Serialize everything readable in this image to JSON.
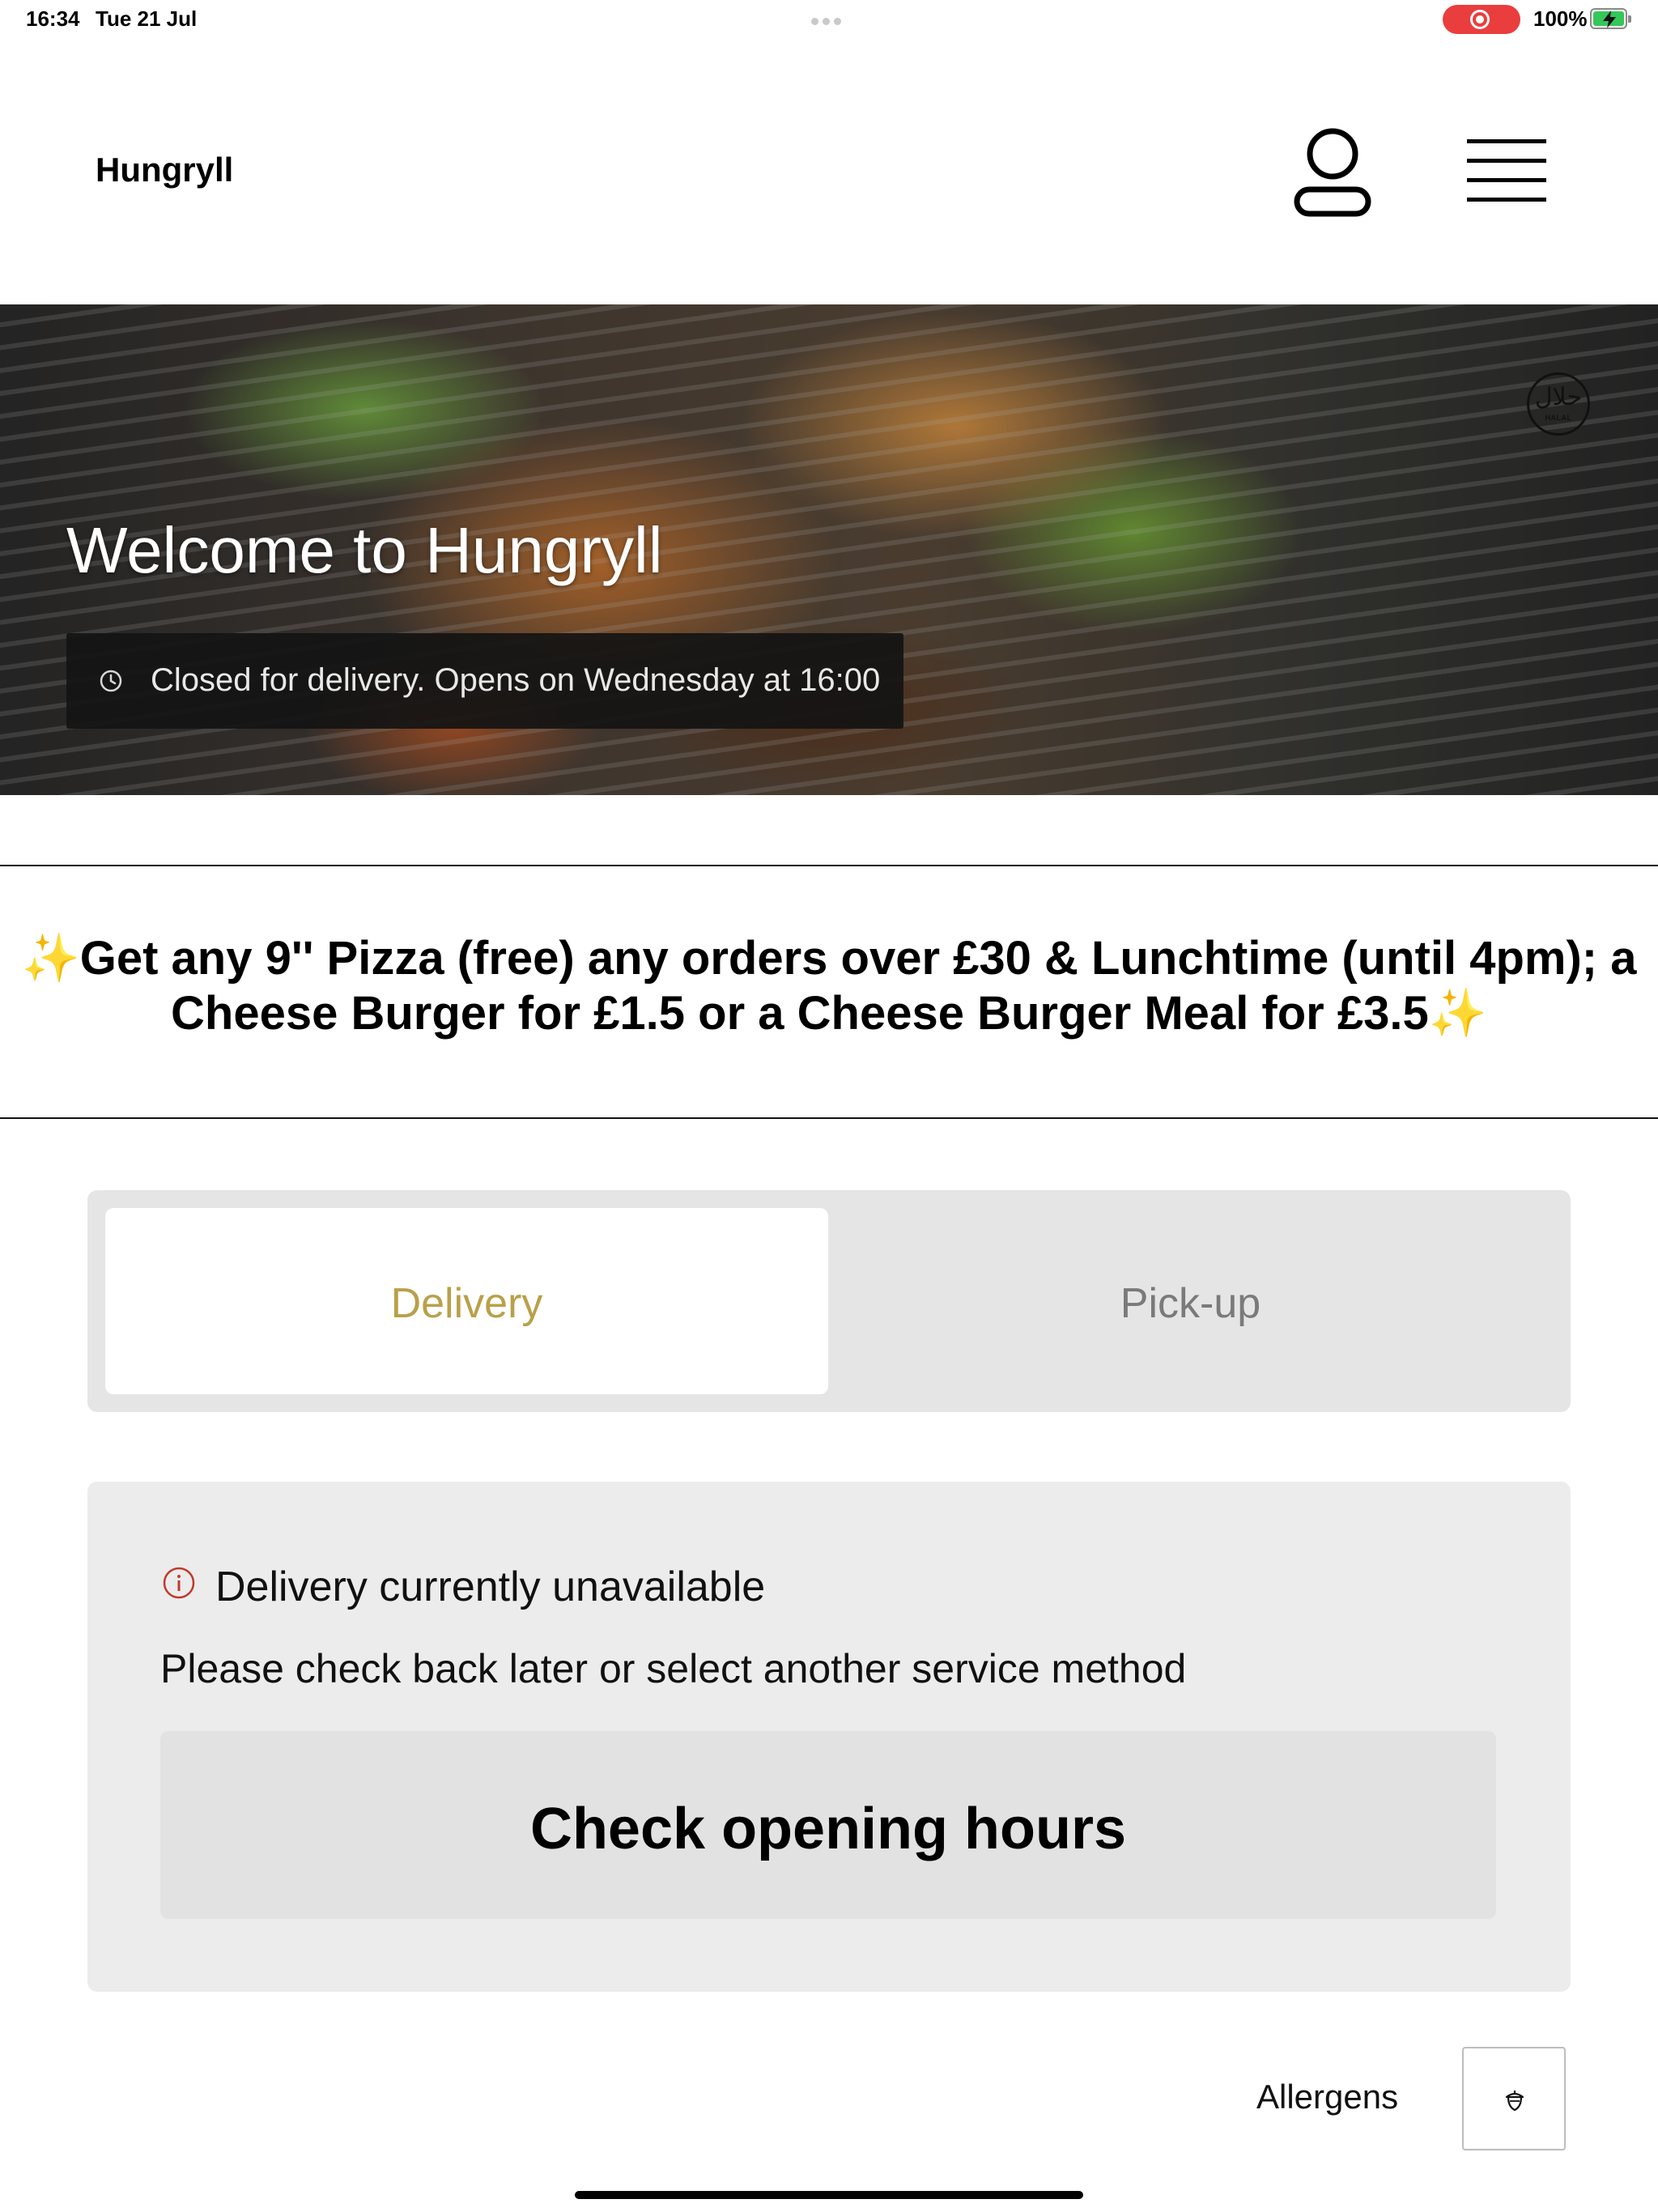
{
  "status_bar": {
    "time": "16:34",
    "date": "Tue 21 Jul",
    "battery_percent": "100%",
    "battery_level": 1.0,
    "charging": true,
    "screen_recording": true
  },
  "header": {
    "brand": "Hungryll",
    "account_icon": "person-icon",
    "menu_icon": "hamburger-menu-icon"
  },
  "hero": {
    "title": "Welcome to Hungryll",
    "status_text": "Closed for delivery. Opens on Wednesday at 16:00",
    "status_icon": "clock-icon",
    "badge_icon": "halal-badge-icon",
    "badge_text": "HALAL"
  },
  "promo": {
    "line1": "✨Get any 9'' Pizza (free) any orders over £30 & Lunchtime (until 4pm); a",
    "line2": "Cheese Burger for £1.5 or a Cheese Burger Meal for £3.5✨"
  },
  "service_tabs": {
    "items": [
      {
        "label": "Delivery",
        "selected": true
      },
      {
        "label": "Pick-up",
        "selected": false
      }
    ],
    "selected_color": "#b9a04a"
  },
  "notice": {
    "icon": "info-icon",
    "icon_color": "#c0392b",
    "heading": "Delivery currently unavailable",
    "message": "Please check back later or select another service method",
    "button_label": "Check opening hours"
  },
  "allergens": {
    "label": "Allergens",
    "icon": "acorn-icon"
  }
}
